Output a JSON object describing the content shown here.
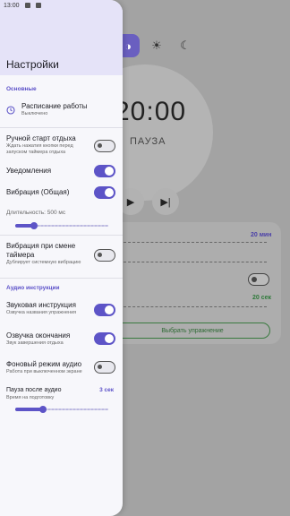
{
  "status_bar": {
    "time": "13:00"
  },
  "background": {
    "timer_value": "20:00",
    "timer_state": "ПАУЗА",
    "value_1": "20 мин",
    "value_2": "20 сек",
    "select_button": "Выбрать упражнение"
  },
  "drawer": {
    "title": "Настройки",
    "sections": {
      "basic": "Основные",
      "audio": "Аудио инструкции"
    },
    "schedule": {
      "label": "Расписание работы",
      "sub": "Выключено"
    },
    "manual_start": {
      "label": "Ручной старт отдыха",
      "sub": "Ждать нажатия кнопки перед запуском таймера отдыха",
      "on": false
    },
    "notifications": {
      "label": "Уведомления",
      "on": true
    },
    "vibration": {
      "label": "Вибрация (Общая)",
      "on": true
    },
    "duration": {
      "label": "Длительность: 500 мс",
      "fraction": 0.2
    },
    "vibration_switch": {
      "label": "Вибрация при смене таймера",
      "sub": "Дублирует системную вибрацию",
      "on": false
    },
    "voice_instruction": {
      "label": "Звуковая инструкция",
      "sub": "Озвучка названия упражнения",
      "on": true
    },
    "voice_end": {
      "label": "Озвучка окончания",
      "sub": "Звук завершения отдыха",
      "on": true
    },
    "background_audio": {
      "label": "Фоновый режим аудио",
      "sub": "Работа при выключенном экране",
      "on": false
    },
    "pause_after_audio": {
      "label": "Пауза после аудио",
      "sub": "Время на подготовку",
      "value": "3 сек",
      "fraction": 0.3
    }
  }
}
